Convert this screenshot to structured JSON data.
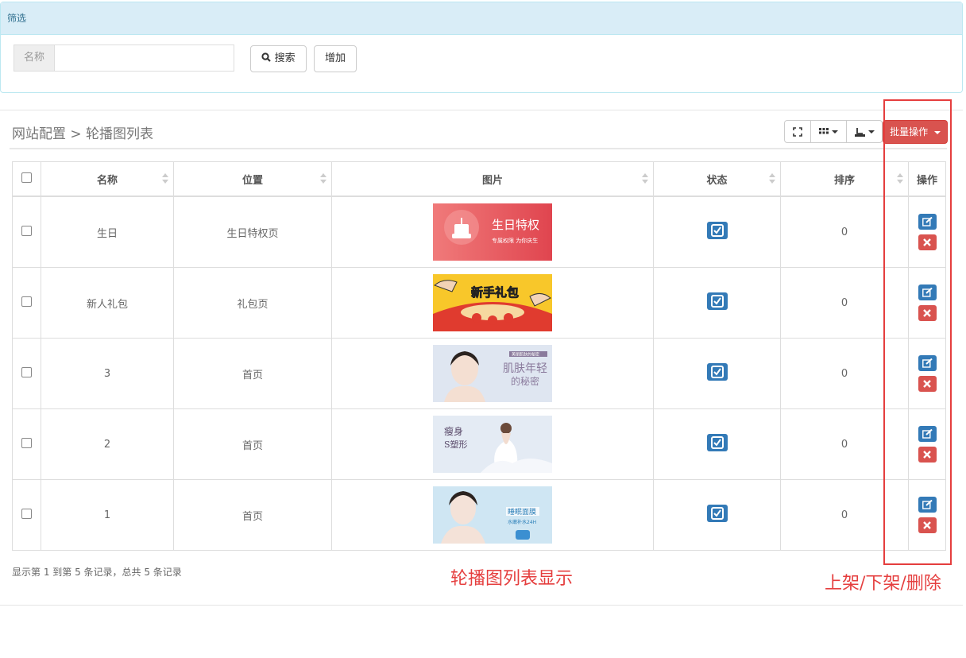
{
  "filter": {
    "heading": "筛选",
    "name_label": "名称",
    "name_value": "",
    "search_label": "搜索",
    "add_label": "增加"
  },
  "panel": {
    "breadcrumb": "网站配置 > 轮播图列表",
    "batch_label": "批量操作"
  },
  "table": {
    "columns": [
      "名称",
      "位置",
      "图片",
      "状态",
      "排序",
      "操作"
    ],
    "rows": [
      {
        "name": "生日",
        "position": "生日特权页",
        "image": "birthday-banner",
        "sort": "0"
      },
      {
        "name": "新人礼包",
        "position": "礼包页",
        "image": "newcomer-gift-banner",
        "sort": "0"
      },
      {
        "name": "3",
        "position": "首页",
        "image": "skin-youth-banner",
        "sort": "0"
      },
      {
        "name": "2",
        "position": "首页",
        "image": "body-shaping-banner",
        "sort": "0"
      },
      {
        "name": "1",
        "position": "首页",
        "image": "sleep-mask-banner",
        "sort": "0"
      }
    ]
  },
  "banners": {
    "birthday_title": "生日特权",
    "birthday_sub": "专属权限 为你庆生",
    "gift_title": "新手礼包",
    "skin_title": "肌肤年轻",
    "skin_sub": "的秘密",
    "skin_tag": "美丽肌肤的秘密",
    "shape_title": "瘦身",
    "shape_sub": "S塑形",
    "sleep_title": "睡眠面膜",
    "sleep_sub": "水嫩补水24H"
  },
  "summary": "显示第 1 到第 5 条记录，总共 5 条记录",
  "annotations": {
    "list_display": "轮播图列表显示",
    "operations": "上架/下架/删除"
  },
  "colors": {
    "primary": "#337ab7",
    "danger": "#d9534f",
    "annotation": "#e53e3e",
    "filter_head": "#d9edf7"
  }
}
